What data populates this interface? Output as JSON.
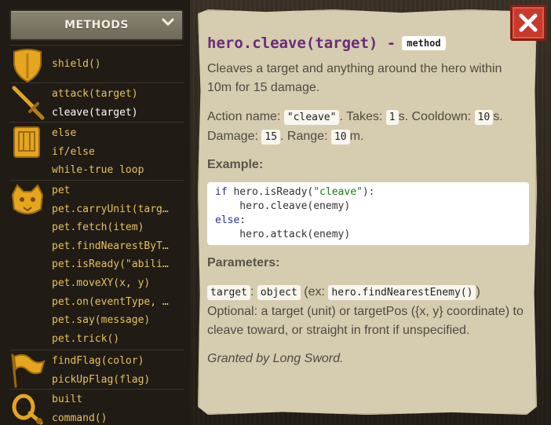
{
  "methods_panel": {
    "title": "METHODS",
    "groups": [
      {
        "icon": "shield-icon",
        "items": [
          "shield()"
        ]
      },
      {
        "icon": "sword-icon",
        "items": [
          "attack(target)",
          "cleave(target)"
        ]
      },
      {
        "icon": "spellbook-icon",
        "items": [
          "else",
          "if/else",
          "while-true loop"
        ]
      },
      {
        "icon": "pet-cougar-icon",
        "items": [
          "pet",
          "pet.carryUnit(targ…",
          "pet.fetch(item)",
          "pet.findNearestByT…",
          "pet.isReady(\"abili…",
          "pet.moveXY(x, y)",
          "pet.on(eventType, …",
          "pet.say(message)",
          "pet.trick()"
        ]
      },
      {
        "icon": "flag-icon",
        "items": [
          "findFlag(color)",
          "pickUpFlag(flag)"
        ]
      },
      {
        "icon": "ring-icon",
        "items": [
          "built",
          "command()"
        ]
      }
    ],
    "selected": "cleave(target)"
  },
  "doc": {
    "title": "hero.cleave(target) -",
    "kind": "method",
    "description": "Cleaves a target and anything around the hero within 10m for 15 damage.",
    "action_label": "Action name:",
    "action_value": "\"cleave\"",
    "takes_label": ". Takes:",
    "takes_value": "1",
    "cooldown_label": "s. Cooldown:",
    "cooldown_value": "10",
    "damage_label": "s. Damage:",
    "damage_value": "15",
    "range_label": ". Range:",
    "range_value": "10",
    "range_unit": "m.",
    "example_heading": "Example:",
    "example_code": {
      "l1_kw": "if",
      "l1_a": " hero.isReady(",
      "l1_str": "\"cleave\"",
      "l1_b": "):",
      "l2": "    hero.cleave(enemy)",
      "l3_kw": "else",
      "l3_b": ":",
      "l4": "    hero.attack(enemy)"
    },
    "params_heading": "Parameters:",
    "param_name": "target",
    "param_sep": ":",
    "param_type": "object",
    "param_ex_open": "(ex:",
    "param_example": "hero.findNearestEnemy()",
    "param_ex_close": ")",
    "param_desc": "Optional: a target (unit) or targetPos ({x, y} coordinate) to cleave toward, or straight in front if unspecified.",
    "granted_by": "Granted by Long Sword."
  },
  "colors": {
    "method_item": "#e6c25a",
    "selected_item": "#ffffff",
    "doc_title": "#6b2a7a",
    "close_button": "#c9392b"
  }
}
